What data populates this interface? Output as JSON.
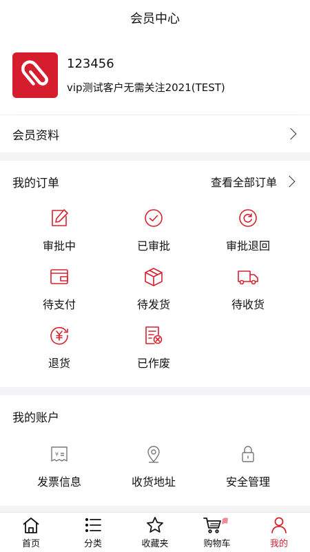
{
  "header": {
    "title": "会员中心"
  },
  "profile": {
    "user_id": "123456",
    "description": "vip测试客户无需关注2021(TEST)"
  },
  "member_info": {
    "label": "会员资料"
  },
  "orders": {
    "title": "我的订单",
    "view_all": "查看全部订单",
    "items": [
      {
        "label": "审批中",
        "icon": "edit-icon"
      },
      {
        "label": "已审批",
        "icon": "check-circle-icon"
      },
      {
        "label": "审批退回",
        "icon": "return-circle-icon"
      },
      {
        "label": "待支付",
        "icon": "wallet-icon"
      },
      {
        "label": "待发货",
        "icon": "package-icon"
      },
      {
        "label": "待收货",
        "icon": "truck-icon"
      },
      {
        "label": "退货",
        "icon": "yuan-refund-icon"
      },
      {
        "label": "已作废",
        "icon": "void-document-icon"
      }
    ]
  },
  "accounts": {
    "title": "我的账户",
    "items": [
      {
        "label": "发票信息",
        "icon": "invoice-icon"
      },
      {
        "label": "收货地址",
        "icon": "location-pin-icon"
      },
      {
        "label": "安全管理",
        "icon": "lock-icon"
      }
    ]
  },
  "tabbar": {
    "items": [
      {
        "label": "首页",
        "icon": "home-icon"
      },
      {
        "label": "分类",
        "icon": "list-icon"
      },
      {
        "label": "收藏夹",
        "icon": "star-icon"
      },
      {
        "label": "购物车",
        "icon": "cart-icon"
      },
      {
        "label": "我的",
        "icon": "user-icon"
      }
    ],
    "active_index": 4
  },
  "colors": {
    "accent": "#d6202e",
    "background": "#f4f4f6",
    "text": "#111111"
  }
}
